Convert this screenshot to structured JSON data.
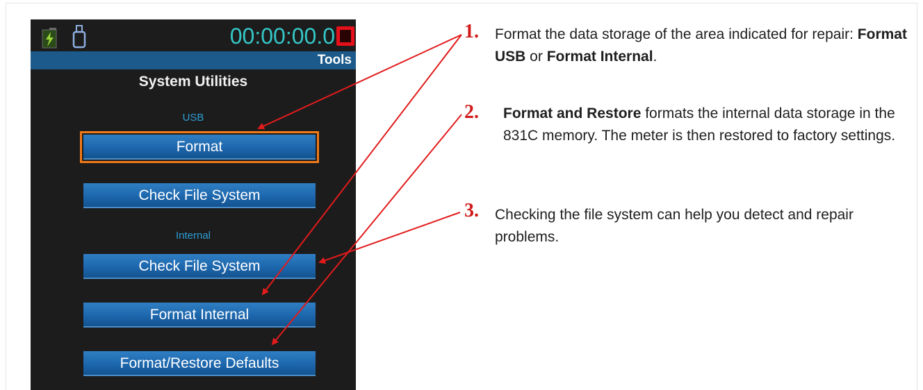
{
  "device": {
    "timer": "00:00:00.0",
    "tab_title": "Tools",
    "screen_title": "System Utilities",
    "usb_label": "USB",
    "internal_label": "Internal",
    "buttons": {
      "usb_format": "Format",
      "usb_check": "Check File System",
      "internal_check": "Check File System",
      "internal_format": "Format Internal",
      "restore_defaults": "Format/Restore Defaults"
    },
    "icons": [
      "battery-icon",
      "usb-icon",
      "record-icon"
    ],
    "colors": {
      "accent": "#1b5a8a",
      "selected_outline": "#f07a1a",
      "timer": "#35c7c7",
      "record": "#e6101a"
    }
  },
  "annotations": [
    {
      "number": "1.",
      "parts": [
        {
          "text": "Format the data storage of the area indicated for repair: ",
          "bold": false
        },
        {
          "text": "Format USB",
          "bold": true
        },
        {
          "text": " or ",
          "bold": false
        },
        {
          "text": "Format Internal",
          "bold": true
        },
        {
          "text": ".",
          "bold": false
        }
      ]
    },
    {
      "number": "2.",
      "parts": [
        {
          "text": "Format and Restore",
          "bold": true
        },
        {
          "text": " formats the internal data storage in the 831C memory. The meter is then restored to factory settings.",
          "bold": false
        }
      ]
    },
    {
      "number": "3.",
      "parts": [
        {
          "text": "Checking the file system can help you detect and repair problems.",
          "bold": false
        }
      ]
    }
  ],
  "arrow_color": "#e21b1b"
}
